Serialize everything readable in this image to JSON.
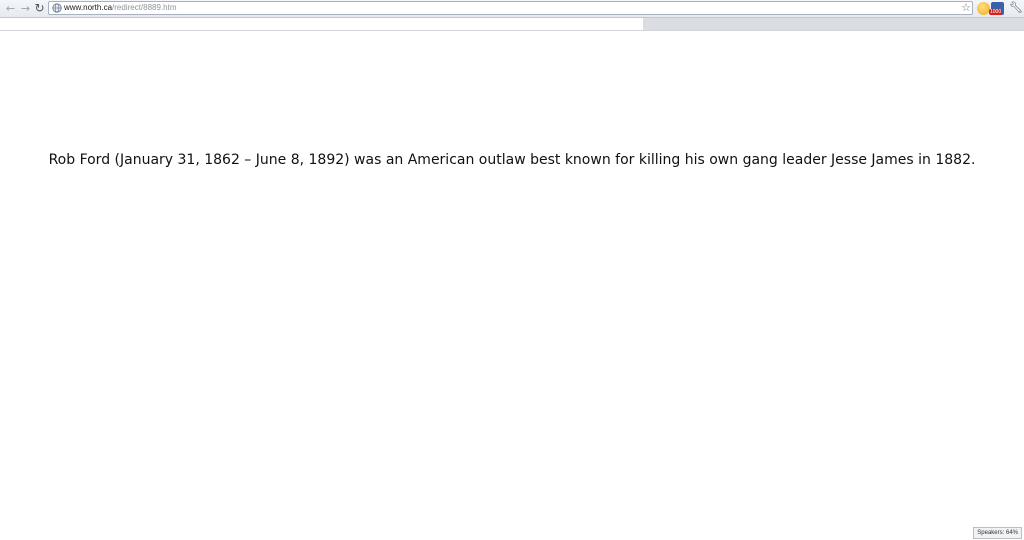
{
  "browser": {
    "address": {
      "host": "www.north.ca",
      "path": "/redirect/8889.htm"
    },
    "icons": {
      "back": "back-arrow-icon",
      "forward": "forward-arrow-icon",
      "reload": "reload-icon",
      "globe": "globe-icon",
      "star": "star-icon",
      "emoji_extension": "smiley-icon",
      "mail_extension": "mail-icon",
      "wrench": "wrench-icon"
    },
    "extension_badge": "1000",
    "load_progress_fraction": 0.63
  },
  "page": {
    "sentence": "Rob Ford (January 31, 1862 – June 8, 1892) was an American outlaw best known for killing his own gang leader Jesse James in 1882."
  },
  "status_bar": {
    "text": "Speakers: 64%"
  },
  "colors": {
    "toolbar_bg": "#e6eaf0",
    "badge_red": "#d72020",
    "text": "#111111"
  }
}
